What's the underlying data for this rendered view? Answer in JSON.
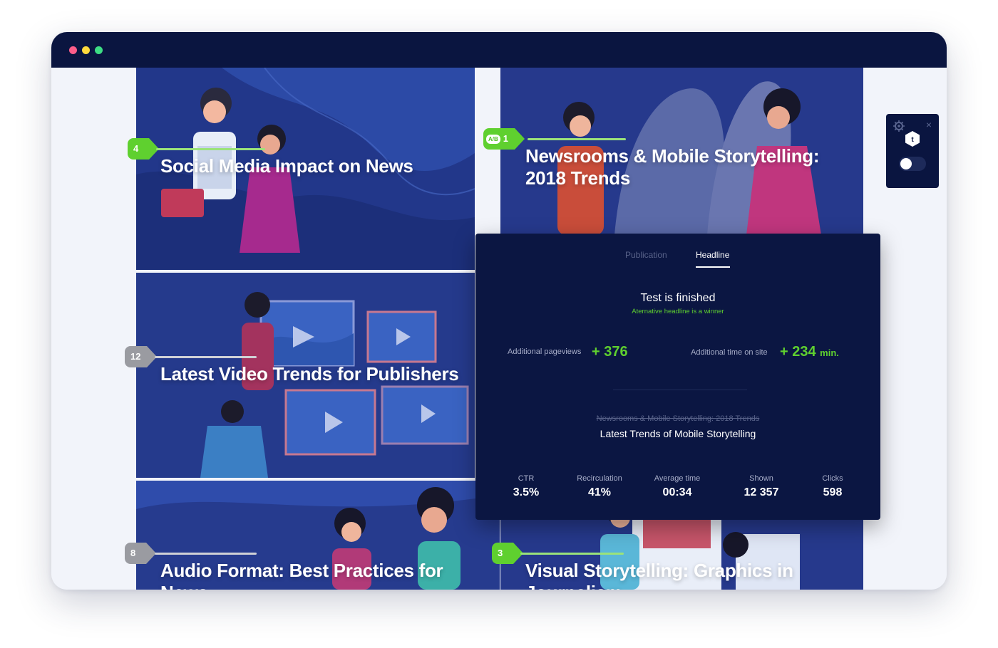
{
  "articles": [
    {
      "rank": "4",
      "title": "Social Media Impact on News",
      "marker_color": "green",
      "ab": false
    },
    {
      "rank": "1",
      "title": "Newsrooms & Mobile Storytelling: 2018 Trends",
      "marker_color": "green",
      "ab": true,
      "ab_label": "A/B"
    },
    {
      "rank": "12",
      "title": "Latest Video Trends for Publishers",
      "marker_color": "gray",
      "ab": false
    },
    {
      "rank": "8",
      "title": "Audio Format: Best Practices for News",
      "marker_color": "gray",
      "ab": false
    },
    {
      "rank": "3",
      "title": "Visual Storytelling: Graphics in Journalism",
      "marker_color": "green",
      "ab": false
    }
  ],
  "side_panel": {
    "logo_letter": "t",
    "toggle_on": false,
    "close_symbol": "×"
  },
  "popup": {
    "tabs": [
      "Publication",
      "Headline"
    ],
    "active_tab": "Headline",
    "status_title": "Test is finished",
    "status_subtitle": "Aternative headline is a winner",
    "pageviews_label": "Additional pageviews",
    "pageviews_value": "+ 376",
    "time_label": "Additional time on site",
    "time_value": "+ 234",
    "time_unit": "min.",
    "old_headline": "Newsrooms & Mobile Storytelling: 2018 Trends",
    "new_headline": "Latest Trends of Mobile Storytelling",
    "stats": [
      {
        "label": "CTR",
        "value": "3.5%"
      },
      {
        "label": "Recirculation",
        "value": "41%"
      },
      {
        "label": "Average time",
        "value": "00:34"
      },
      {
        "label": "Shown",
        "value": "12 357"
      },
      {
        "label": "Clicks",
        "value": "598"
      }
    ]
  },
  "colors": {
    "titlebar": "#0a1540",
    "tile_blue": "#223a8c",
    "popup_bg": "#0b1642",
    "accent_green": "#5fd02f",
    "marker_gray": "#9a9ba1"
  }
}
